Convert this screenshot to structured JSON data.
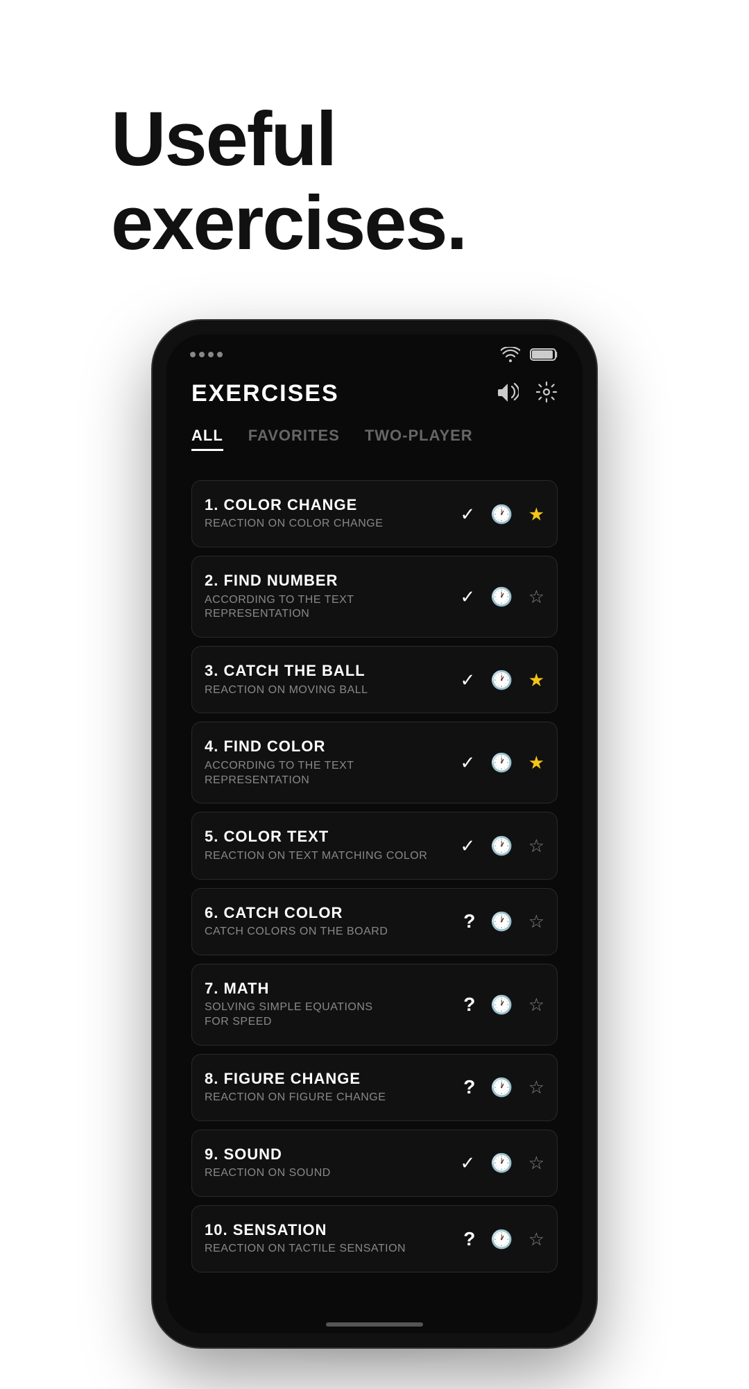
{
  "header": {
    "title": "Useful\nexercises."
  },
  "screen": {
    "title": "EXERCISES",
    "sound_icon": "🔊",
    "settings_icon": "⚙",
    "tabs": [
      {
        "label": "ALL",
        "active": true
      },
      {
        "label": "FAVORITES",
        "active": false
      },
      {
        "label": "TWO-PLAYER",
        "active": false
      }
    ],
    "exercises": [
      {
        "number": "1.",
        "name": "COLOR CHANGE",
        "desc": "REACTION ON COLOR CHANGE",
        "status": "check",
        "favorite": true
      },
      {
        "number": "2.",
        "name": "FIND NUMBER",
        "desc": "ACCORDING TO THE TEXT\nREPRESENTATION",
        "status": "check",
        "favorite": false
      },
      {
        "number": "3.",
        "name": "CATCH THE BALL",
        "desc": "REACTION ON MOVING BALL",
        "status": "check",
        "favorite": true
      },
      {
        "number": "4.",
        "name": "FIND COLOR",
        "desc": "ACCORDING TO THE TEXT\nREPRESENTATION",
        "status": "check",
        "favorite": true
      },
      {
        "number": "5.",
        "name": "COLOR TEXT",
        "desc": "REACTION ON TEXT MATCHING COLOR",
        "status": "check",
        "favorite": false
      },
      {
        "number": "6.",
        "name": "CATCH COLOR",
        "desc": "CATCH COLORS ON THE BOARD",
        "status": "question",
        "favorite": false
      },
      {
        "number": "7.",
        "name": "MATH",
        "desc": "SOLVING SIMPLE EQUATIONS\nFOR SPEED",
        "status": "question",
        "favorite": false
      },
      {
        "number": "8.",
        "name": "FIGURE CHANGE",
        "desc": "REACTION ON FIGURE CHANGE",
        "status": "question",
        "favorite": false
      },
      {
        "number": "9.",
        "name": "SOUND",
        "desc": "REACTION ON SOUND",
        "status": "check",
        "favorite": false
      },
      {
        "number": "10.",
        "name": "SENSATION",
        "desc": "REACTION ON TACTILE SENSATION",
        "status": "question",
        "favorite": false
      }
    ]
  }
}
